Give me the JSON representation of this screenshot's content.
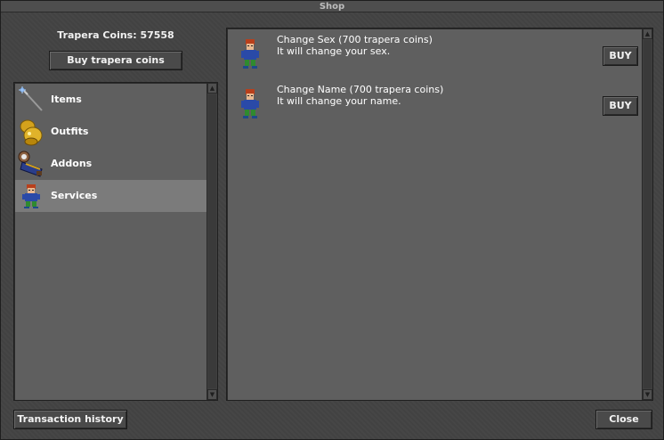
{
  "window": {
    "title": "Shop"
  },
  "coins": {
    "label": "Trapera Coins: 57558"
  },
  "buttons": {
    "buy_coins": "Buy trapera coins",
    "history": "Transaction history",
    "close": "Close"
  },
  "categories": [
    {
      "label": "Items",
      "icon": "wand-icon",
      "selected": false
    },
    {
      "label": "Outfits",
      "icon": "gold-armor-icon",
      "selected": false
    },
    {
      "label": "Addons",
      "icon": "addon-outfit-icon",
      "selected": false
    },
    {
      "label": "Services",
      "icon": "character-icon",
      "selected": true
    }
  ],
  "offers": [
    {
      "title": "Change Sex (700 trapera coins)",
      "description": "It will change your sex.",
      "buy_label": "BUY",
      "icon": "character-icon"
    },
    {
      "title": "Change Name (700 trapera coins)",
      "description": "It will change your name.",
      "buy_label": "BUY",
      "icon": "character-icon"
    }
  ],
  "colors": {
    "window_bg": "#434343",
    "panel_bg": "#5f5f5f",
    "selected_row": "#7b7b7b",
    "text": "#ffffff"
  }
}
